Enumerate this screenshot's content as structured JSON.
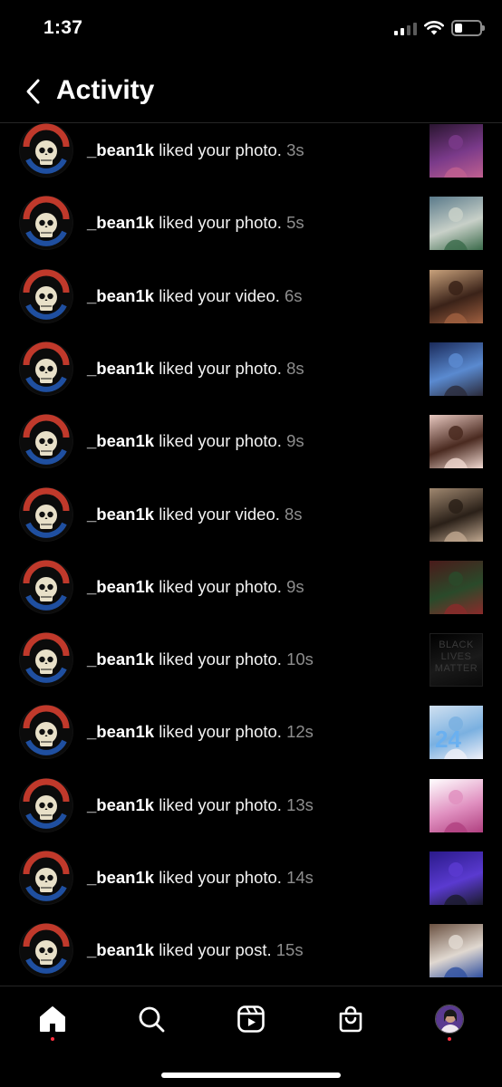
{
  "status_bar": {
    "time": "1:37",
    "battery_percent": 30
  },
  "header": {
    "title": "Activity",
    "back_icon": "chevron-left-icon"
  },
  "activities": [
    {
      "username": "_bean1k",
      "action": "liked your photo.",
      "time": "3s",
      "thumb_colors": [
        "#2a1530",
        "#7a3a8a",
        "#c06090"
      ]
    },
    {
      "username": "_bean1k",
      "action": "liked your photo.",
      "time": "5s",
      "thumb_colors": [
        "#5a7a8a",
        "#c8d0c8",
        "#3a6a4a"
      ]
    },
    {
      "username": "_bean1k",
      "action": "liked your video.",
      "time": "6s",
      "thumb_colors": [
        "#c9a27c",
        "#3a2218",
        "#a06040"
      ]
    },
    {
      "username": "_bean1k",
      "action": "liked your photo.",
      "time": "8s",
      "thumb_colors": [
        "#1a2a5a",
        "#5a8ad0",
        "#2a2a3a"
      ]
    },
    {
      "username": "_bean1k",
      "action": "liked your photo.",
      "time": "9s",
      "thumb_colors": [
        "#e8c8c0",
        "#4a2a20",
        "#f0d8d0"
      ]
    },
    {
      "username": "_bean1k",
      "action": "liked your video.",
      "time": "8s",
      "thumb_colors": [
        "#a08870",
        "#2a2018",
        "#c0a890"
      ]
    },
    {
      "username": "_bean1k",
      "action": "liked your photo.",
      "time": "9s",
      "thumb_colors": [
        "#4a1a1a",
        "#2a4a2a",
        "#8a2a2a"
      ]
    },
    {
      "username": "_bean1k",
      "action": "liked your photo.",
      "time": "10s",
      "thumb_colors": [
        "#000000",
        "#1a1a1a",
        "#0a0a0a"
      ]
    },
    {
      "username": "_bean1k",
      "action": "liked your photo.",
      "time": "12s",
      "thumb_colors": [
        "#d0e0f0",
        "#7ab0e0",
        "#f0f0f8"
      ]
    },
    {
      "username": "_bean1k",
      "action": "liked your photo.",
      "time": "13s",
      "thumb_colors": [
        "#ffffff",
        "#e090c0",
        "#b04080"
      ]
    },
    {
      "username": "_bean1k",
      "action": "liked your photo.",
      "time": "14s",
      "thumb_colors": [
        "#2a1a8a",
        "#5a3ad0",
        "#1a1a2a"
      ]
    },
    {
      "username": "_bean1k",
      "action": "liked your post.",
      "time": "15s",
      "thumb_colors": [
        "#6a5040",
        "#e0d8d0",
        "#3050a0"
      ]
    }
  ],
  "thumb_labels": {
    "row8": [
      "BLACK",
      "LIVES",
      "MATTER"
    ],
    "row9": "24"
  },
  "tabs": [
    {
      "name": "home",
      "icon": "home-icon",
      "active": true,
      "dot": true
    },
    {
      "name": "search",
      "icon": "search-icon",
      "active": false,
      "dot": false
    },
    {
      "name": "reels",
      "icon": "reels-icon",
      "active": false,
      "dot": false
    },
    {
      "name": "shop",
      "icon": "shop-icon",
      "active": false,
      "dot": false
    },
    {
      "name": "profile",
      "icon": "profile-avatar",
      "active": false,
      "dot": true
    }
  ],
  "colors": {
    "background": "#000000",
    "muted": "#8e8e8e",
    "notification_dot": "#ff3040",
    "avatar_ring": "#c0392b",
    "avatar_skull": "#1f4fa0"
  }
}
